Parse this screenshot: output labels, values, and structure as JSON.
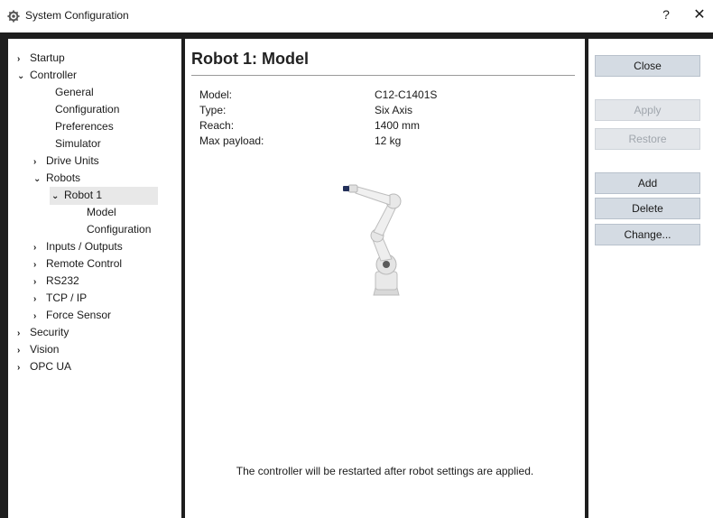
{
  "window": {
    "title": "System Configuration",
    "help_label": "?",
    "close_label": "✕",
    "icon": "gear-icon"
  },
  "tree": {
    "items": [
      {
        "label": "Startup",
        "chevron": "›"
      },
      {
        "label": "Controller",
        "chevron": "⌄"
      },
      {
        "label": "General",
        "chevron": ""
      },
      {
        "label": "Configuration",
        "chevron": ""
      },
      {
        "label": "Preferences",
        "chevron": ""
      },
      {
        "label": "Simulator",
        "chevron": ""
      },
      {
        "label": "Drive Units",
        "chevron": "›"
      },
      {
        "label": "Robots",
        "chevron": "⌄"
      },
      {
        "label": "Robot 1",
        "chevron": "⌄"
      },
      {
        "label": "Model",
        "chevron": ""
      },
      {
        "label": "Configuration",
        "chevron": ""
      },
      {
        "label": "Inputs / Outputs",
        "chevron": "›"
      },
      {
        "label": "Remote Control",
        "chevron": "›"
      },
      {
        "label": "RS232",
        "chevron": "›"
      },
      {
        "label": "TCP / IP",
        "chevron": "›"
      },
      {
        "label": "Force Sensor",
        "chevron": "›"
      },
      {
        "label": "Security",
        "chevron": "›"
      },
      {
        "label": "Vision",
        "chevron": "›"
      },
      {
        "label": "OPC UA",
        "chevron": "›"
      }
    ]
  },
  "main": {
    "title": "Robot 1: Model",
    "properties": [
      {
        "label": "Model:",
        "value": "C12-C1401S"
      },
      {
        "label": "Type:",
        "value": "Six Axis"
      },
      {
        "label": "Reach:",
        "value": "1400 mm"
      },
      {
        "label": "Max payload:",
        "value": "12 kg"
      }
    ],
    "footer_note": "The controller will be restarted after robot settings are applied."
  },
  "buttons": {
    "close": "Close",
    "apply": "Apply",
    "restore": "Restore",
    "add": "Add",
    "delete": "Delete",
    "change": "Change..."
  },
  "colors": {
    "frame": "#1e1e1e",
    "button": "#d4dbe3",
    "button_disabled": "#e3e6ea",
    "selected_row": "#e8e8e8"
  }
}
